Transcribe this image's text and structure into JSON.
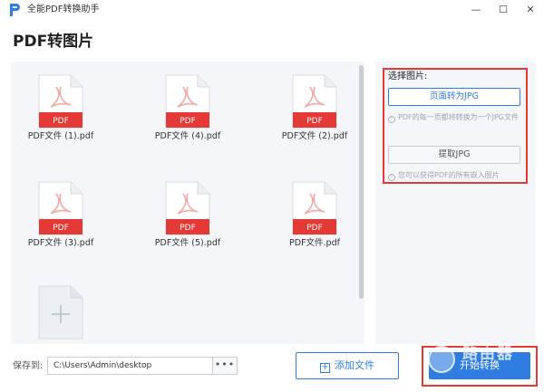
{
  "window": {
    "title": "全能PDF转换助手",
    "controls": {
      "minimize": "—",
      "maximize": "☐",
      "close": "✕"
    }
  },
  "page": {
    "title": "PDF转图片"
  },
  "files": [
    {
      "name": "PDF文件 (1).pdf",
      "badge": "PDF"
    },
    {
      "name": "PDF文件 (4).pdf",
      "badge": "PDF"
    },
    {
      "name": "PDF文件 (2).pdf",
      "badge": "PDF"
    },
    {
      "name": "PDF文件 (3).pdf",
      "badge": "PDF"
    },
    {
      "name": "PDF文件 (5).pdf",
      "badge": "PDF"
    },
    {
      "name": "PDF文件.pdf",
      "badge": "PDF"
    }
  ],
  "options": {
    "label": "选择图片:",
    "page_to_jpg": "页面转为JPG",
    "page_to_jpg_hint": "PDF的每一页都将转换为一个JPG文件",
    "extract_jpg": "提取JPG",
    "extract_jpg_hint": "您可以获得PDF的所有嵌入图片",
    "hint_icon": "!"
  },
  "save": {
    "label": "保存到:",
    "path": "C:\\Users\\Admin\\desktop",
    "browse": "•••"
  },
  "actions": {
    "add_file": "添加文件",
    "add_file_icon": "+",
    "start": "开始转换"
  },
  "watermark": {
    "text": "路由器"
  },
  "colors": {
    "accent": "#2f7de1",
    "pdf_badge": "#e53935",
    "highlight": "#e53935"
  },
  "icons": {
    "logo": "app-logo-icon",
    "file": "pdf-file-icon",
    "add": "add-file-tile-icon"
  }
}
